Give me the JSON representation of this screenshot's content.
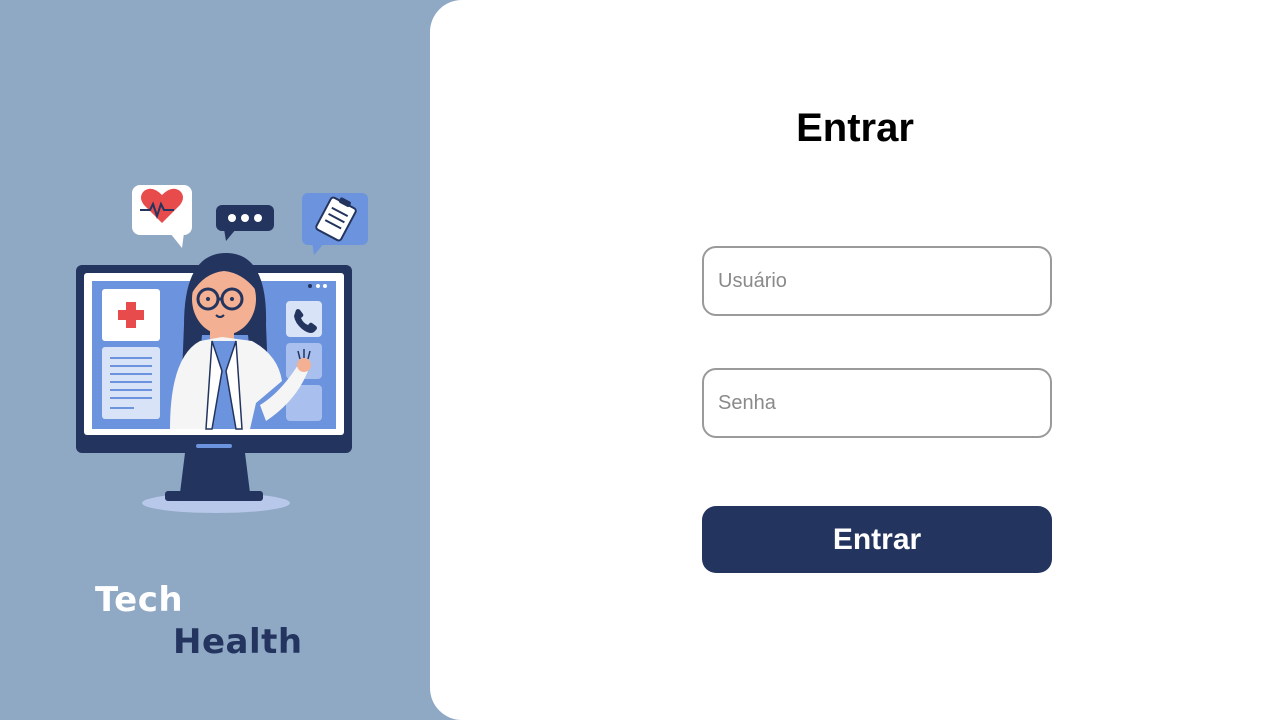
{
  "brand": {
    "line1": "Tech",
    "line2": "Health"
  },
  "login": {
    "title": "Entrar",
    "username_placeholder": "Usuário",
    "password_placeholder": "Senha",
    "submit_label": "Entrar"
  },
  "colors": {
    "left_background": "#8fa8c4",
    "navy": "#23345f",
    "accent_blue": "#6c93dd",
    "heart_red": "#e84b4b"
  },
  "icons": [
    "heart-pulse-icon",
    "chat-bubble-icon",
    "clipboard-icon",
    "medical-cross-icon",
    "phone-icon"
  ]
}
